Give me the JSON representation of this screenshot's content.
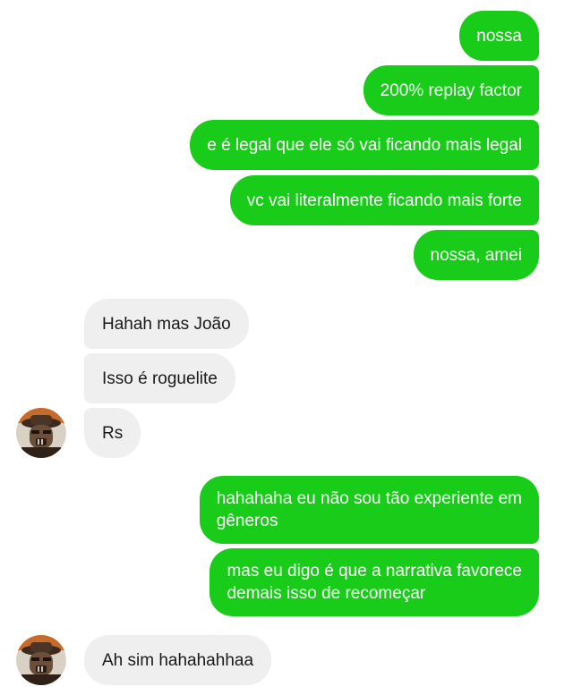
{
  "conversation": {
    "messages": [
      {
        "sender": "me",
        "text": "nossa"
      },
      {
        "sender": "me",
        "text": "200% replay factor"
      },
      {
        "sender": "me",
        "text": "e é legal que ele só vai ficando mais legal"
      },
      {
        "sender": "me",
        "text": "vc vai literalmente ficando mais forte"
      },
      {
        "sender": "me",
        "text": "nossa, amei"
      },
      {
        "sender": "other",
        "text": "Hahah mas João"
      },
      {
        "sender": "other",
        "text": "Isso é roguelite"
      },
      {
        "sender": "other",
        "text": "Rs"
      },
      {
        "sender": "me",
        "text_line1": "hahahaha eu não sou tão experiente em",
        "text_line2": "gêneros"
      },
      {
        "sender": "me",
        "text_line1": "mas eu digo é que a narrativa favorece",
        "text_line2": "demais isso de recomeçar"
      },
      {
        "sender": "other",
        "text": "Ah sim hahahahhaa"
      }
    ]
  },
  "colors": {
    "outgoing_bubble": "#19cc19",
    "incoming_bubble": "#efefef"
  },
  "icons": {
    "avatar": "contact-avatar-icon"
  }
}
